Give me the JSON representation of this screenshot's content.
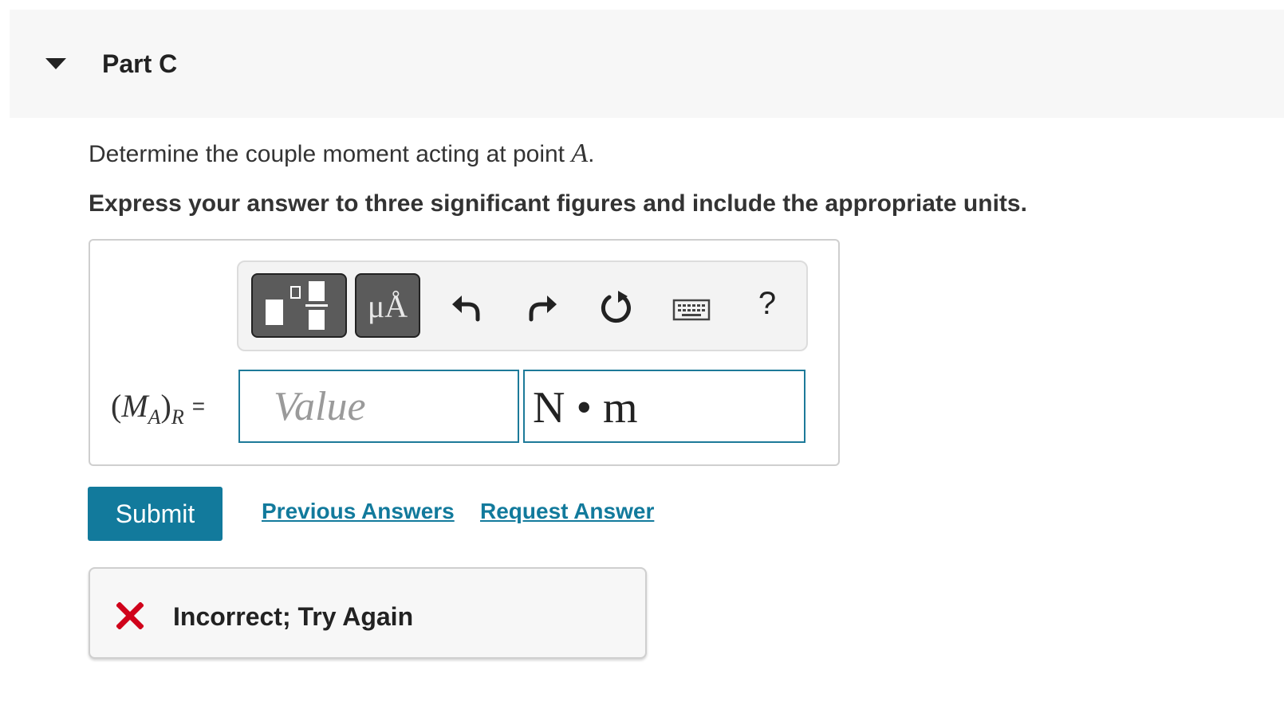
{
  "part": {
    "title": "Part C"
  },
  "question": {
    "text": "Determine the couple moment acting at point ",
    "variable": "A",
    "period": "."
  },
  "instruction": "Express your answer to three significant figures and include the appropriate units.",
  "toolbar": {
    "templates_icon": "fraction-templates-icon",
    "units_label": "μÅ",
    "undo_icon": "undo-icon",
    "redo_icon": "redo-icon",
    "reset_icon": "reset-icon",
    "keyboard_icon": "keyboard-icon",
    "help_label": "?"
  },
  "answer": {
    "label_open": "(",
    "label_var": "M",
    "label_sub": "A",
    "label_close": ")",
    "label_sub2": "R",
    "equals": "=",
    "value_placeholder": "Value",
    "value": "",
    "units": "N • m"
  },
  "actions": {
    "submit": "Submit",
    "previous_answers": "Previous Answers",
    "request_answer": "Request Answer"
  },
  "feedback": {
    "text": "Incorrect; Try Again",
    "icon": "x-icon",
    "icon_color": "#d0021b"
  },
  "colors": {
    "accent": "#127a9c",
    "input_border": "#1d7a99"
  }
}
